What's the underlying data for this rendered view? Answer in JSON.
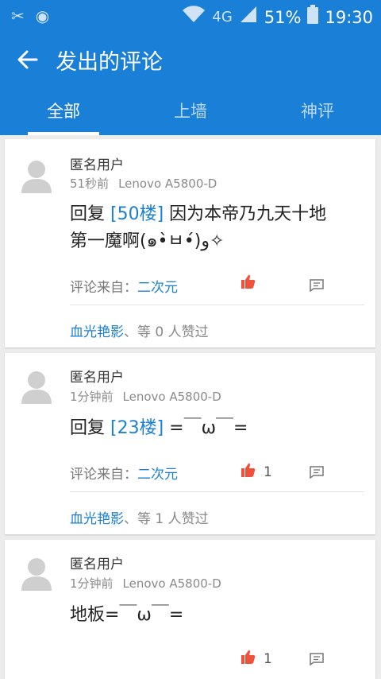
{
  "status": {
    "network": "4G",
    "battery": "51%",
    "time": "19:30",
    "icons": [
      "scissors-icon",
      "record-icon",
      "wifi-icon",
      "signal-icon",
      "battery-icon"
    ]
  },
  "appbar": {
    "title": "发出的评论",
    "back_icon": "arrow-left-icon"
  },
  "tabs": [
    {
      "label": "全部"
    },
    {
      "label": "上墙"
    },
    {
      "label": "神评"
    }
  ],
  "active_tab": "全部",
  "colors": {
    "primary": "#1a7fd6",
    "like": "#f0513a",
    "background": "#ececec"
  },
  "comments": [
    {
      "user": "匿名用户",
      "time": "51秒前",
      "device": "Lenovo A5800-D",
      "reply_prefix": "回复",
      "reply_ref": "[50楼]",
      "text_line1": "  因为本帝乃九天十地",
      "text_line2": "第一魔啊(๑•̀ㅂ•́)و✧",
      "source_label": "评论来自：",
      "source": "二次元",
      "like_count": "",
      "liker": "血光艳影",
      "likers_suffix": "、等 0 人赞过"
    },
    {
      "user": "匿名用户",
      "time": "1分钟前",
      "device": "Lenovo A5800-D",
      "reply_prefix": "回复",
      "reply_ref": "[23楼]",
      "text_line1": "  =￣ω￣=",
      "source_label": "评论来自：",
      "source": "二次元",
      "like_count": "1",
      "liker": "血光艳影",
      "likers_suffix": "、等 1 人赞过"
    },
    {
      "user": "匿名用户",
      "time": "1分钟前",
      "device": "Lenovo A5800-D",
      "text_line1": "地板=￣ω￣=",
      "like_count": "1"
    }
  ]
}
